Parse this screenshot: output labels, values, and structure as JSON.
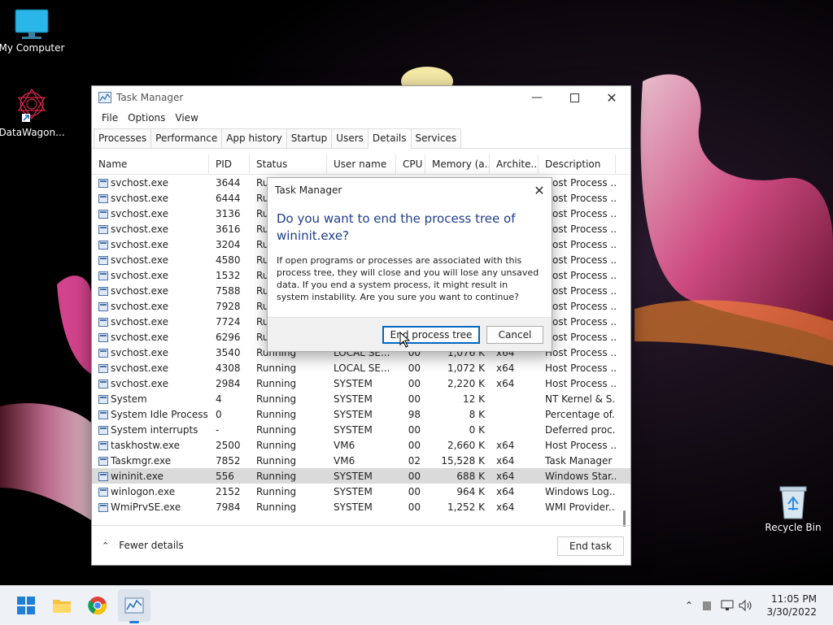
{
  "desktop": {
    "icons": [
      {
        "label": "My Computer"
      },
      {
        "label": "DataWagon..."
      },
      {
        "label": "Recycle Bin"
      }
    ]
  },
  "window": {
    "title": "Task Manager",
    "menu": [
      "File",
      "Options",
      "View"
    ],
    "tabs": [
      "Processes",
      "Performance",
      "App history",
      "Startup",
      "Users",
      "Details",
      "Services"
    ],
    "active_tab": "Details",
    "columns": [
      "Name",
      "PID",
      "Status",
      "User name",
      "CPU",
      "Memory (a...",
      "Archite...",
      "Description"
    ],
    "rows": [
      {
        "name": "svchost.exe",
        "pid": "3644",
        "status": "Ru",
        "user": "",
        "cpu": "",
        "mem": "",
        "arch": "",
        "desc": "Host Process ..."
      },
      {
        "name": "svchost.exe",
        "pid": "6444",
        "status": "Ru",
        "user": "",
        "cpu": "",
        "mem": "",
        "arch": "",
        "desc": "Host Process ..."
      },
      {
        "name": "svchost.exe",
        "pid": "3136",
        "status": "Ru",
        "user": "",
        "cpu": "",
        "mem": "",
        "arch": "",
        "desc": "Host Process ..."
      },
      {
        "name": "svchost.exe",
        "pid": "3616",
        "status": "Ru",
        "user": "",
        "cpu": "",
        "mem": "",
        "arch": "",
        "desc": "Host Process ..."
      },
      {
        "name": "svchost.exe",
        "pid": "3204",
        "status": "Ru",
        "user": "",
        "cpu": "",
        "mem": "",
        "arch": "",
        "desc": "Host Process ..."
      },
      {
        "name": "svchost.exe",
        "pid": "4580",
        "status": "Ru",
        "user": "",
        "cpu": "",
        "mem": "",
        "arch": "",
        "desc": "Host Process ..."
      },
      {
        "name": "svchost.exe",
        "pid": "1532",
        "status": "Ru",
        "user": "",
        "cpu": "",
        "mem": "",
        "arch": "",
        "desc": "Host Process ..."
      },
      {
        "name": "svchost.exe",
        "pid": "7588",
        "status": "Ru",
        "user": "",
        "cpu": "",
        "mem": "",
        "arch": "",
        "desc": "Host Process ..."
      },
      {
        "name": "svchost.exe",
        "pid": "7928",
        "status": "Ru",
        "user": "",
        "cpu": "",
        "mem": "",
        "arch": "",
        "desc": "Host Process ..."
      },
      {
        "name": "svchost.exe",
        "pid": "7724",
        "status": "Ru",
        "user": "",
        "cpu": "",
        "mem": "",
        "arch": "",
        "desc": "Host Process ..."
      },
      {
        "name": "svchost.exe",
        "pid": "6296",
        "status": "Ru",
        "user": "",
        "cpu": "",
        "mem": "",
        "arch": "",
        "desc": "Host Process ..."
      },
      {
        "name": "svchost.exe",
        "pid": "3540",
        "status": "Running",
        "user": "LOCAL SE...",
        "cpu": "00",
        "mem": "1,076 K",
        "arch": "x64",
        "desc": "Host Process ..."
      },
      {
        "name": "svchost.exe",
        "pid": "4308",
        "status": "Running",
        "user": "LOCAL SE...",
        "cpu": "00",
        "mem": "1,072 K",
        "arch": "x64",
        "desc": "Host Process ..."
      },
      {
        "name": "svchost.exe",
        "pid": "2984",
        "status": "Running",
        "user": "SYSTEM",
        "cpu": "00",
        "mem": "2,220 K",
        "arch": "x64",
        "desc": "Host Process ..."
      },
      {
        "name": "System",
        "pid": "4",
        "status": "Running",
        "user": "SYSTEM",
        "cpu": "00",
        "mem": "12 K",
        "arch": "",
        "desc": "NT Kernel & S..."
      },
      {
        "name": "System Idle Process",
        "pid": "0",
        "status": "Running",
        "user": "SYSTEM",
        "cpu": "98",
        "mem": "8 K",
        "arch": "",
        "desc": "Percentage of..."
      },
      {
        "name": "System interrupts",
        "pid": "-",
        "status": "Running",
        "user": "SYSTEM",
        "cpu": "00",
        "mem": "0 K",
        "arch": "",
        "desc": "Deferred proc..."
      },
      {
        "name": "taskhostw.exe",
        "pid": "2500",
        "status": "Running",
        "user": "VM6",
        "cpu": "00",
        "mem": "2,660 K",
        "arch": "x64",
        "desc": "Host Process ..."
      },
      {
        "name": "Taskmgr.exe",
        "pid": "7852",
        "status": "Running",
        "user": "VM6",
        "cpu": "02",
        "mem": "15,528 K",
        "arch": "x64",
        "desc": "Task Manager"
      },
      {
        "name": "wininit.exe",
        "pid": "556",
        "status": "Running",
        "user": "SYSTEM",
        "cpu": "00",
        "mem": "688 K",
        "arch": "x64",
        "desc": "Windows Star...",
        "selected": true
      },
      {
        "name": "winlogon.exe",
        "pid": "2152",
        "status": "Running",
        "user": "SYSTEM",
        "cpu": "00",
        "mem": "964 K",
        "arch": "x64",
        "desc": "Windows Log..."
      },
      {
        "name": "WmiPrvSE.exe",
        "pid": "7984",
        "status": "Running",
        "user": "SYSTEM",
        "cpu": "00",
        "mem": "1,252 K",
        "arch": "x64",
        "desc": "WMI Provider..."
      }
    ],
    "fewer_details": "Fewer details",
    "end_task": "End task"
  },
  "dialog": {
    "title": "Task Manager",
    "heading": "Do you want to end the process tree of wininit.exe?",
    "body": "If open programs or processes are associated with this process tree, they will close and you will lose any unsaved data. If you end a system process, it might result in system instability. Are you sure you want to continue?",
    "confirm": "End process tree",
    "cancel": "Cancel"
  },
  "taskbar": {
    "time": "11:05 PM",
    "date": "3/30/2022"
  }
}
